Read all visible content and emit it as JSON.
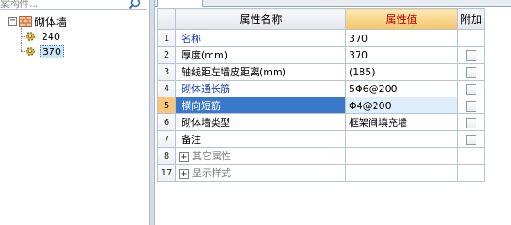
{
  "search": {
    "placeholder": "案构件..."
  },
  "tree": {
    "root": {
      "expander": "−",
      "label": "砌体墙"
    },
    "children": [
      {
        "label": "240",
        "selected": false
      },
      {
        "label": "370",
        "selected": true
      }
    ]
  },
  "grid": {
    "headers": {
      "name": "属性名称",
      "value": "属性值",
      "extra": "附加"
    },
    "rows": [
      {
        "num": "1",
        "name": "名称",
        "value": "370",
        "checkbox": false
      },
      {
        "num": "2",
        "name": "厚度(mm)",
        "value": "370",
        "checkbox": true
      },
      {
        "num": "3",
        "name": "轴线距左墙皮距离(mm)",
        "value": "(185)",
        "checkbox": true
      },
      {
        "num": "4",
        "name": "砌体通长筋",
        "value": "5Φ6@200",
        "checkbox": true
      },
      {
        "num": "5",
        "name": "横向短筋",
        "value": "Φ4@200",
        "checkbox": true
      },
      {
        "num": "6",
        "name": "砌体墙类型",
        "value": "框架间填充墙",
        "checkbox": true
      },
      {
        "num": "7",
        "name": "备注",
        "value": "",
        "checkbox": true
      },
      {
        "num": "8",
        "expander": "+",
        "name": "其它属性",
        "value": "",
        "checkbox": false
      },
      {
        "num": "17",
        "expander": "+",
        "name": "显示样式",
        "value": "",
        "checkbox": false
      }
    ]
  },
  "colors": {
    "selected_name_bg": "#3a78c9",
    "header_value_text": "#c00000",
    "link_text": "#1f3fa8"
  }
}
